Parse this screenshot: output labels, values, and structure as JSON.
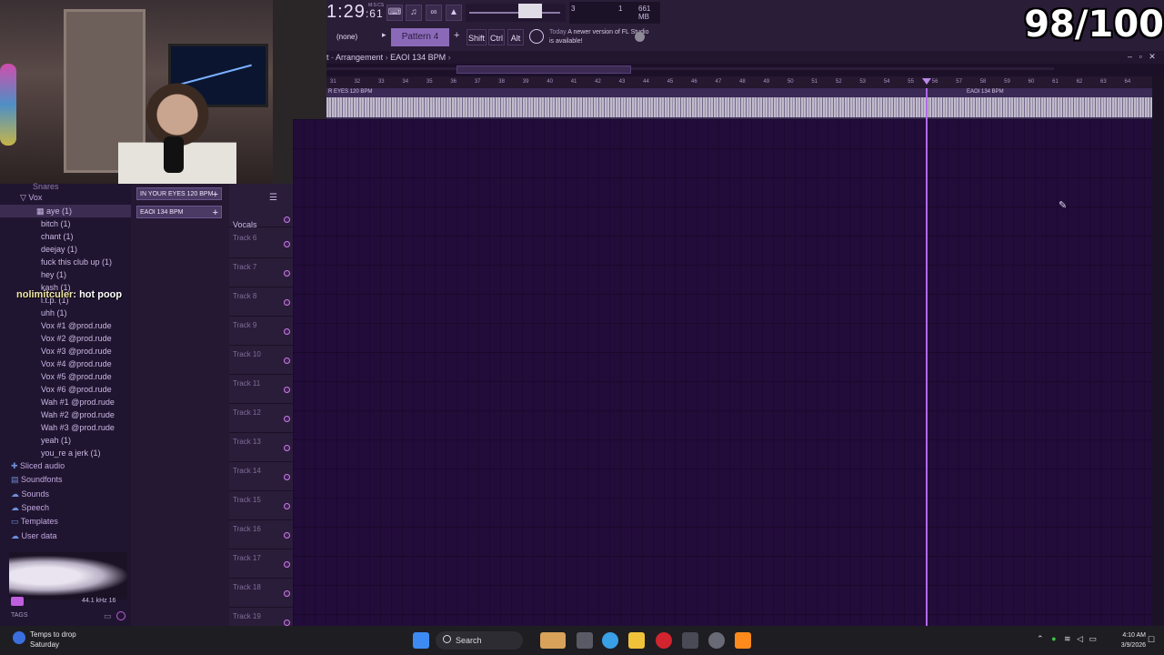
{
  "toolbar": {
    "time": "1:29",
    "time_frac": ":61",
    "time_unit": "M:S:CS",
    "cpu_ram": "661 MB",
    "cpu_a": "3",
    "cpu_b": "1",
    "pattern_selector": "(none)",
    "pattern": "Pattern 4",
    "mod_shift": "Shift",
    "mod_ctrl": "Ctrl",
    "mod_alt": "Alt",
    "news_day": "Today",
    "news_text": "A newer version of FL Studio is available!"
  },
  "score": "98/100",
  "arrangement": {
    "prefix": "t",
    "name": "Arrangement",
    "pattern": "EAOI 134 BPM",
    "ruler": [
      "31",
      "32",
      "33",
      "34",
      "35",
      "36",
      "37",
      "38",
      "39",
      "40",
      "41",
      "42",
      "43",
      "44",
      "45",
      "46",
      "47",
      "48",
      "49",
      "50",
      "51",
      "52",
      "53",
      "54",
      "55",
      "56",
      "57",
      "58",
      "59",
      "60",
      "61",
      "62",
      "63",
      "64"
    ],
    "clip1": "R EYES 120 BPM",
    "clip2": "EAOI 134 BPM"
  },
  "clips": [
    "IN YOUR EYES 120 BPM",
    "EAOI 134 BPM"
  ],
  "tracks": {
    "vocals": "Vocals",
    "names": [
      "Track 6",
      "Track 7",
      "Track 8",
      "Track 9",
      "Track 10",
      "Track 11",
      "Track 12",
      "Track 13",
      "Track 14",
      "Track 15",
      "Track 16",
      "Track 17",
      "Track 18",
      "Track 19"
    ]
  },
  "browser": {
    "top_cut": "Snares",
    "folder": "Vox",
    "items": [
      "aye (1)",
      "bitch (1)",
      "chant (1)",
      "deejay (1)",
      "fuck this club up (1)",
      "hey (1)",
      "kash (1)",
      "l.t.p. (1)",
      "uhh (1)",
      "Vox #1 @prod.rude",
      "Vox #2 @prod.rude",
      "Vox #3 @prod.rude",
      "Vox #4 @prod.rude",
      "Vox #5 @prod.rude",
      "Vox #6 @prod.rude",
      "Wah #1 @prod.rude",
      "Wah #2 @prod.rude",
      "Wah #3 @prod.rude",
      "yeah (1)",
      "you_re a jerk (1)"
    ],
    "roots": [
      "Sliced audio",
      "Soundfonts",
      "Sounds",
      "Speech",
      "Templates",
      "User data"
    ],
    "sample_rate": "44.1 kHz 16",
    "tags": "TAGS"
  },
  "chat": {
    "user": "nolimitculer",
    "message": ": hot poop"
  },
  "taskbar": {
    "weather_title": "Temps to drop",
    "weather_sub": "Saturday",
    "search": "Search",
    "time": "4:10 AM",
    "date": "3/9/2026"
  }
}
